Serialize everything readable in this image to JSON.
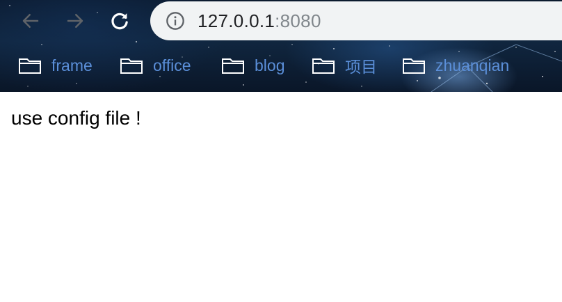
{
  "toolbar": {
    "back_icon": "arrow-left-icon",
    "forward_icon": "arrow-right-icon",
    "reload_icon": "reload-icon"
  },
  "omnibox": {
    "info_icon": "info-icon",
    "host": "127.0.0.1",
    "port": ":8080"
  },
  "bookmarks": [
    {
      "label": "frame",
      "icon": "folder-icon"
    },
    {
      "label": "office",
      "icon": "folder-icon"
    },
    {
      "label": "blog",
      "icon": "folder-icon"
    },
    {
      "label": "项目",
      "icon": "folder-icon"
    },
    {
      "label": "zhuanqian",
      "icon": "folder-icon"
    }
  ],
  "colors": {
    "bookmark_text": "#5b8fd9",
    "omnibox_bg": "#f1f3f4",
    "port_text": "#80868b"
  },
  "page": {
    "body_text": "use config file !"
  }
}
